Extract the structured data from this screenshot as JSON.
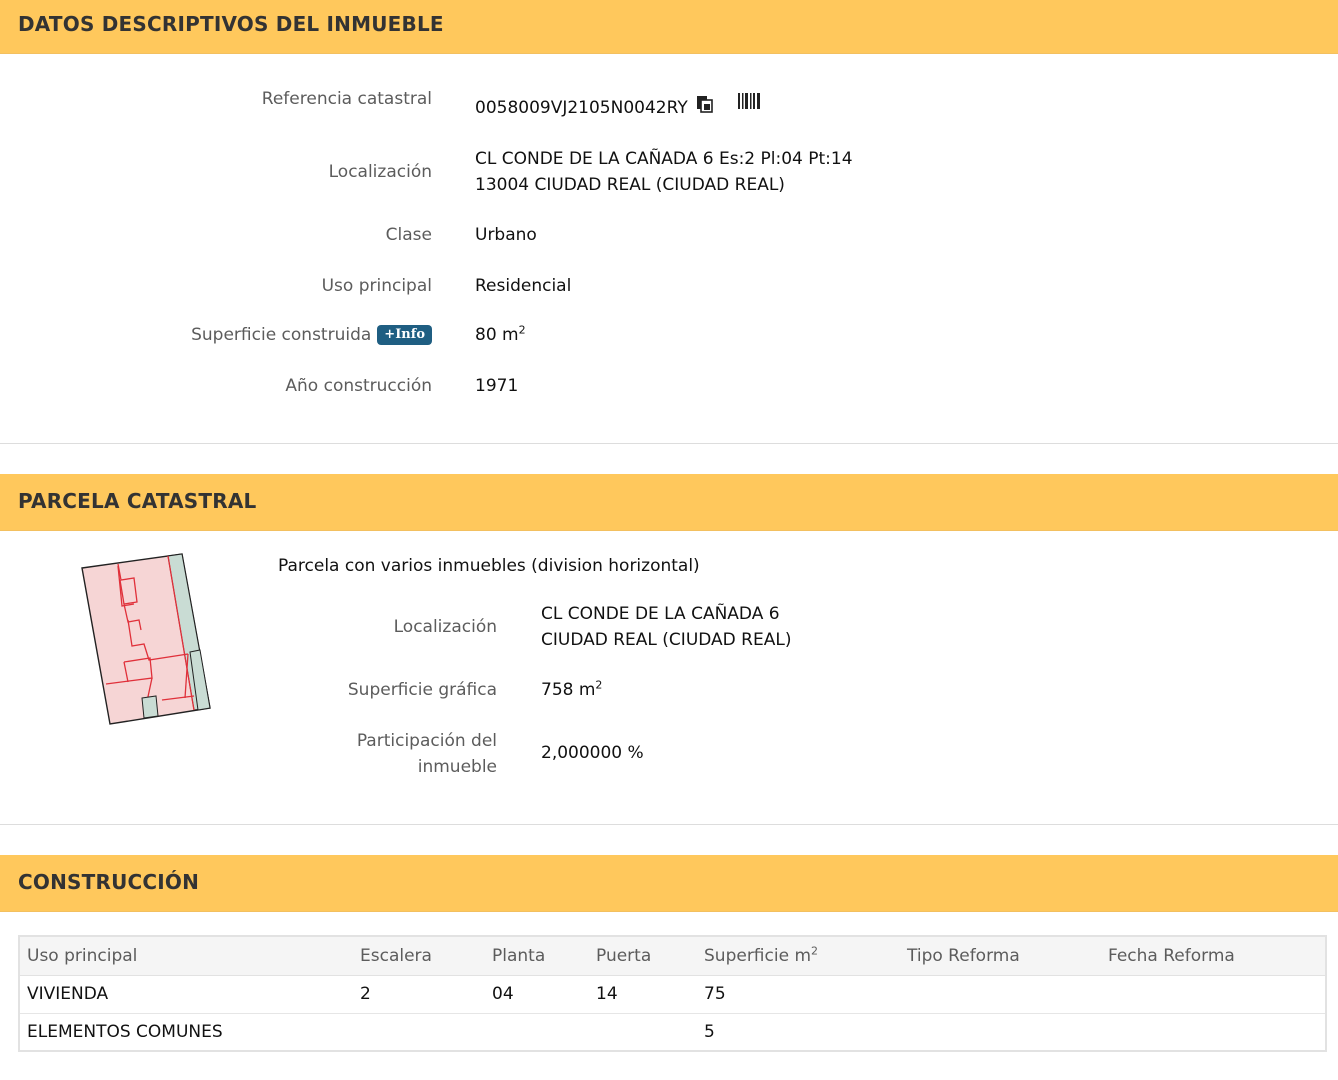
{
  "datos": {
    "header": "DATOS DESCRIPTIVOS DEL INMUEBLE",
    "referencia_label": "Referencia catastral",
    "referencia_value": "0058009VJ2105N0042RY",
    "localizacion_label": "Localización",
    "localizacion_line1": "CL CONDE DE LA CAÑADA 6 Es:2 Pl:04 Pt:14",
    "localizacion_line2": "13004 CIUDAD REAL (CIUDAD REAL)",
    "clase_label": "Clase",
    "clase_value": "Urbano",
    "uso_label": "Uso principal",
    "uso_value": "Residencial",
    "superficie_label": "Superficie construida",
    "info_badge": "+Info",
    "superficie_value": "80 m",
    "superficie_unit_sup": "2",
    "anio_label": "Año construcción",
    "anio_value": "1971"
  },
  "parcela": {
    "header": "PARCELA CATASTRAL",
    "description": "Parcela con varios inmuebles (division horizontal)",
    "localizacion_label": "Localización",
    "localizacion_line1": "CL CONDE DE LA CAÑADA 6",
    "localizacion_line2": "CIUDAD REAL (CIUDAD REAL)",
    "superficie_label": "Superficie gráfica",
    "superficie_value": "758 m",
    "superficie_unit_sup": "2",
    "participacion_label_line1": "Participación del",
    "participacion_label_line2": "inmueble",
    "participacion_value": "2,000000 %"
  },
  "construccion": {
    "header": "CONSTRUCCIÓN",
    "columns": {
      "uso": "Uso principal",
      "escalera": "Escalera",
      "planta": "Planta",
      "puerta": "Puerta",
      "superficie": "Superficie m",
      "superficie_sup": "2",
      "tipo_reforma": "Tipo Reforma",
      "fecha_reforma": "Fecha Reforma"
    },
    "rows": [
      {
        "uso": "VIVIENDA",
        "escalera": "2",
        "planta": "04",
        "puerta": "14",
        "superficie": "75",
        "tipo_reforma": "",
        "fecha_reforma": ""
      },
      {
        "uso": "ELEMENTOS COMUNES",
        "escalera": "",
        "planta": "",
        "puerta": "",
        "superficie": "5",
        "tipo_reforma": "",
        "fecha_reforma": ""
      }
    ]
  },
  "colors": {
    "header_bg": "#ffc85c",
    "badge_bg": "#1f5e82",
    "parcel_fill": "#f6d5d5",
    "parcel_common_fill": "#c9dcd4",
    "parcel_line": "#e0303a"
  },
  "icons": {
    "copy": "copy-icon",
    "barcode": "barcode-icon",
    "parcel_map": "parcel-sketch"
  }
}
